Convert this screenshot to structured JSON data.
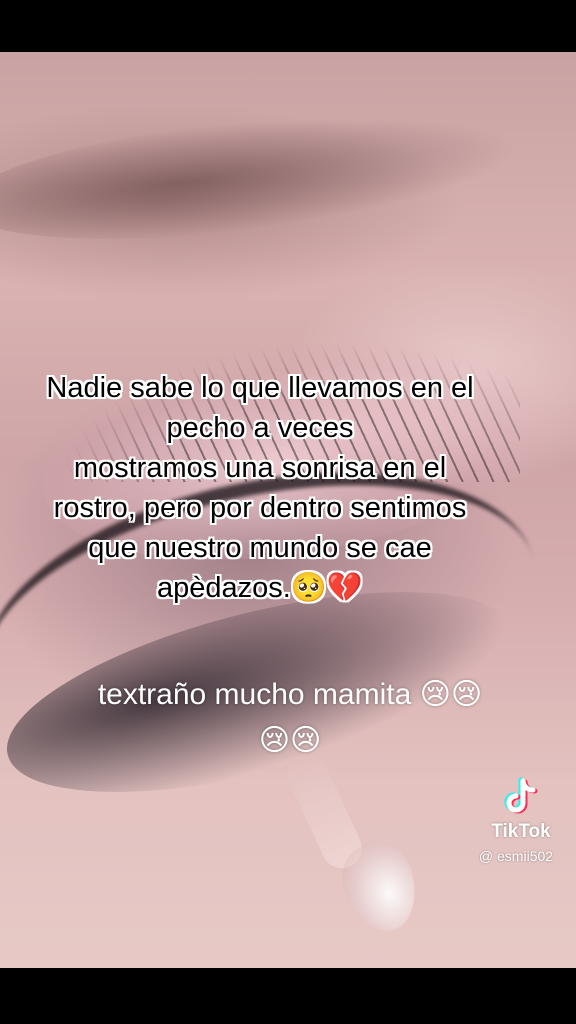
{
  "caption_top": {
    "lines": [
      "Nadie sabe lo que llevamos en el",
      "pecho a veces",
      "mostramos una sonrisa en el",
      "rostro, pero por dentro sentimos",
      "que nuestro mundo se cae",
      "apèdazos.🥺💔"
    ]
  },
  "caption_bottom": {
    "lines": [
      "textraño mucho mamita 😢😢",
      "😢😢"
    ]
  },
  "watermark": {
    "brand": "TikTok",
    "handle": "@ esmii502",
    "logo_icon": "tiktok-note-icon"
  },
  "colors": {
    "caption_fill": "#000000",
    "caption_outline": "#ffffff",
    "logo_cyan": "#25f4ee",
    "logo_red": "#fe2c55"
  }
}
